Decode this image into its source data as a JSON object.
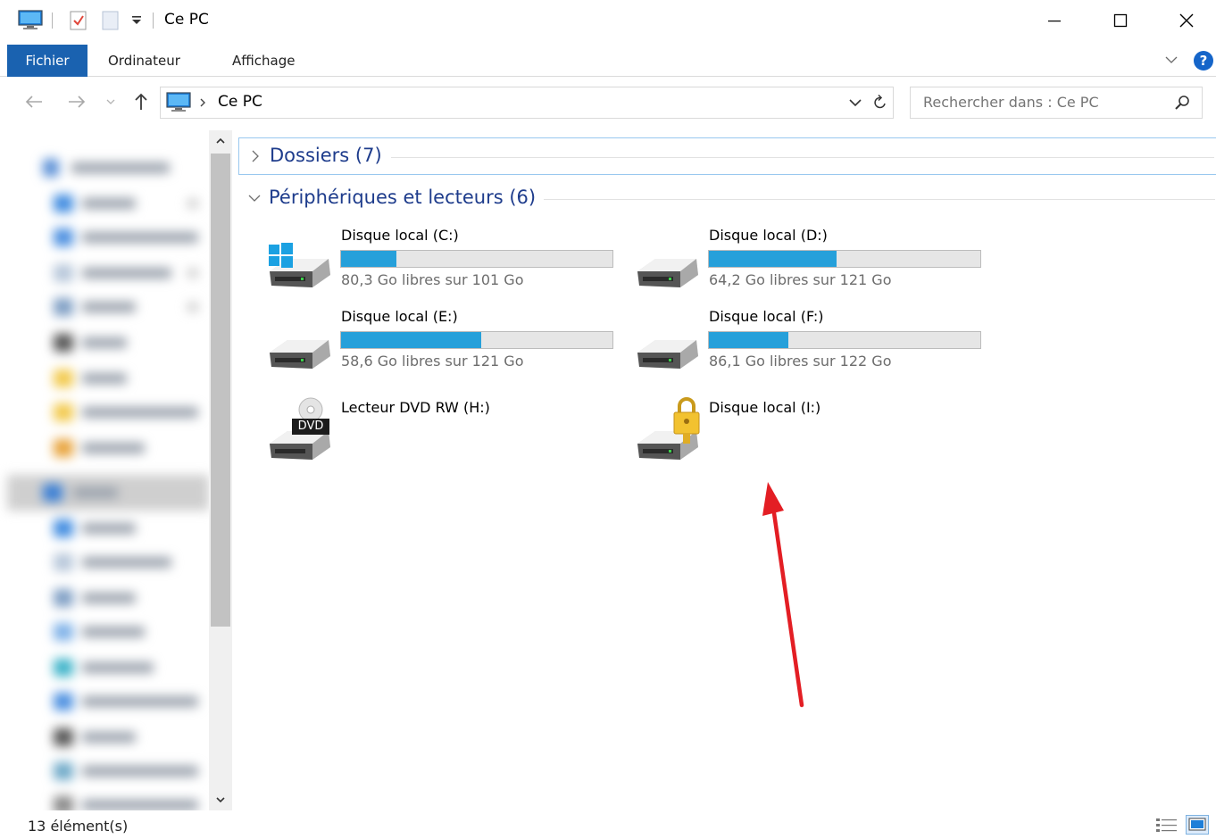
{
  "window": {
    "title": "Ce PC"
  },
  "ribbon": {
    "tabs": [
      {
        "label": "Fichier"
      },
      {
        "label": "Ordinateur"
      },
      {
        "label": "Affichage"
      }
    ],
    "help_label": "?"
  },
  "address_bar": {
    "path": "Ce PC",
    "search_placeholder": "Rechercher dans : Ce PC"
  },
  "groups": {
    "folders": {
      "label": "Dossiers (7)",
      "expanded": false
    },
    "devices": {
      "label": "Périphériques et lecteurs (6)",
      "expanded": true
    }
  },
  "drives": [
    {
      "name": "Disque local (C:)",
      "free": "80,3 Go libres sur 101 Go",
      "used_fraction": 0.205,
      "icon": "windows-drive-icon"
    },
    {
      "name": "Disque local (D:)",
      "free": "64,2 Go libres sur 121 Go",
      "used_fraction": 0.469,
      "icon": "hard-drive-icon"
    },
    {
      "name": "Disque local (E:)",
      "free": "58,6 Go libres sur 121 Go",
      "used_fraction": 0.516,
      "icon": "hard-drive-icon"
    },
    {
      "name": "Disque local (F:)",
      "free": "86,1 Go libres sur 122 Go",
      "used_fraction": 0.294,
      "icon": "hard-drive-icon"
    },
    {
      "name": "Lecteur DVD RW (H:)",
      "free": "",
      "icon": "dvd-drive-icon",
      "badge": "DVD"
    },
    {
      "name": "Disque local (I:)",
      "free": "",
      "icon": "locked-drive-icon"
    }
  ],
  "status_bar": {
    "item_count": "13 élément(s)"
  },
  "colors": {
    "accent": "#1a62b0",
    "usage_bar": "#26a0da",
    "group_title": "#1e3c8c",
    "annotation_arrow": "#e31e24"
  }
}
